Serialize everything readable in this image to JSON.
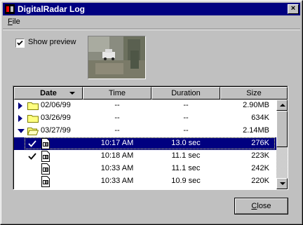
{
  "window": {
    "title": "DigitalRadar Log",
    "close_glyph": "×"
  },
  "menu": {
    "file_label": "File"
  },
  "options": {
    "show_preview_label": "Show preview",
    "show_preview_checked": true
  },
  "list": {
    "columns": [
      "Date",
      "Time",
      "Duration",
      "Size"
    ],
    "sorted_column": "Date",
    "rows": [
      {
        "type": "folder",
        "state": "collapsed",
        "date": "02/06/99",
        "time": "--",
        "duration": "--",
        "size": "2.90MB"
      },
      {
        "type": "folder",
        "state": "collapsed",
        "date": "03/26/99",
        "time": "--",
        "duration": "--",
        "size": "634K"
      },
      {
        "type": "folder",
        "state": "expanded",
        "date": "03/27/99",
        "time": "--",
        "duration": "--",
        "size": "2.14MB"
      },
      {
        "type": "file",
        "checked": true,
        "selected": true,
        "time": "10:17 AM",
        "duration": "13.0 sec",
        "size": "276K"
      },
      {
        "type": "file",
        "checked": true,
        "selected": false,
        "time": "10:18 AM",
        "duration": "11.1 sec",
        "size": "223K"
      },
      {
        "type": "file",
        "checked": false,
        "selected": false,
        "time": "10:33 AM",
        "duration": "11.1 sec",
        "size": "242K"
      },
      {
        "type": "file",
        "checked": false,
        "selected": false,
        "time": "10:33 AM",
        "duration": "10.9 sec",
        "size": "220K"
      }
    ]
  },
  "buttons": {
    "close_label": "Close"
  },
  "colors": {
    "titlebar": "#000080",
    "selection": "#000080",
    "face": "#c0c0c0",
    "folder": "#ffff80"
  }
}
